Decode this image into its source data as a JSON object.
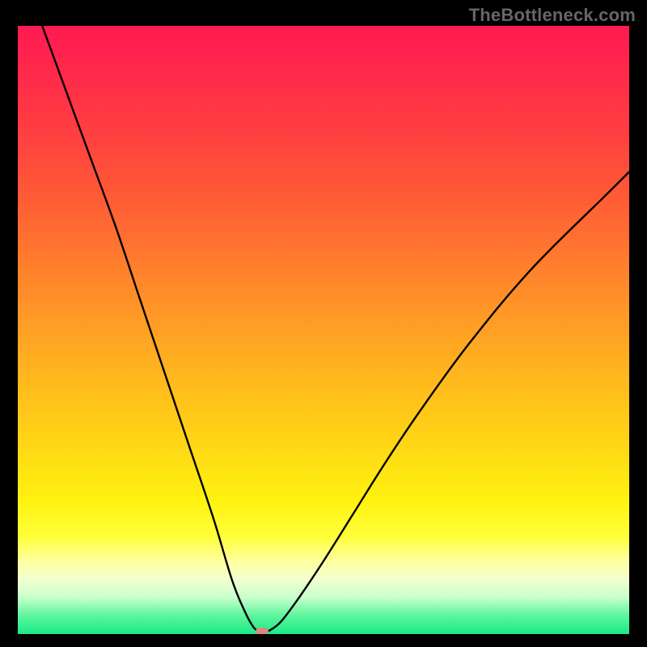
{
  "watermark": "TheBottleneck.com",
  "chart_data": {
    "type": "line",
    "title": "",
    "xlabel": "",
    "ylabel": "",
    "x_range": [
      0,
      100
    ],
    "y_range": [
      0,
      100
    ],
    "grid": false,
    "series": [
      {
        "name": "bottleneck-curve",
        "x": [
          4,
          8,
          12,
          16,
          20,
          24,
          28,
          32,
          35,
          37,
          38.5,
          39.5,
          40,
          41,
          43,
          46,
          50,
          55,
          60,
          66,
          74,
          84,
          96,
          100
        ],
        "y": [
          100,
          89,
          78,
          67,
          55,
          43,
          31,
          19,
          9,
          4,
          1.2,
          0.4,
          0.2,
          0.5,
          2,
          6,
          12,
          20,
          28,
          37,
          48,
          60,
          72,
          76
        ]
      }
    ],
    "marker": {
      "name": "bottleneck-point",
      "x": 40,
      "y": 0.4,
      "color": "#d88a80"
    },
    "background": {
      "type": "vertical-gradient",
      "stops": [
        {
          "pos": 0.0,
          "color": "#ff1a52"
        },
        {
          "pos": 0.78,
          "color": "#fff210"
        },
        {
          "pos": 1.0,
          "color": "#19ea86"
        }
      ]
    }
  }
}
